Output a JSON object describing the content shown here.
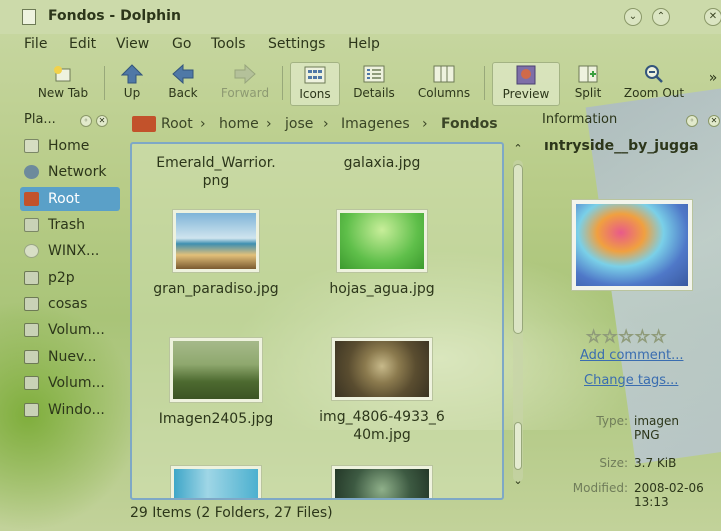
{
  "window": {
    "title": "Fondos - Dolphin",
    "btn_minimize": "⌄",
    "btn_maximize": "⌃",
    "btn_close": "✕"
  },
  "menubar": {
    "file": "File",
    "edit": "Edit",
    "view": "View",
    "go": "Go",
    "tools": "Tools",
    "settings": "Settings",
    "help": "Help"
  },
  "toolbar": {
    "new_tab": "New Tab",
    "up": "Up",
    "back": "Back",
    "forward": "Forward",
    "icons": "Icons",
    "details": "Details",
    "columns": "Columns",
    "preview": "Preview",
    "split": "Split",
    "zoom_out": "Zoom Out",
    "more": "»"
  },
  "places": {
    "title": "Pla...",
    "items": [
      {
        "label": "Home",
        "color": "#d6ddc2"
      },
      {
        "label": "Network",
        "color": "#6d8a9c"
      },
      {
        "label": "Root",
        "color": "#c2522b"
      },
      {
        "label": "Trash",
        "color": "#c9d2b6"
      },
      {
        "label": "WINX...",
        "color": "#c9d2b6"
      },
      {
        "label": "p2p",
        "color": "#c9d2b6"
      },
      {
        "label": "cosas",
        "color": "#c9d2b6"
      },
      {
        "label": "Volum...",
        "color": "#c9d2b6"
      },
      {
        "label": "Nuev...",
        "color": "#c9d2b6"
      },
      {
        "label": "Volum...",
        "color": "#c9d2b6"
      },
      {
        "label": "Windo...",
        "color": "#c9d2b6"
      }
    ]
  },
  "breadcrumb": {
    "items": [
      "Root",
      "home",
      "jose",
      "Imagenes",
      "Fondos"
    ]
  },
  "files": {
    "row0": [
      {
        "name": "Emerald_Warrior.\npng"
      },
      {
        "name": "galaxia.jpg"
      }
    ],
    "row1": [
      {
        "name": "gran_paradiso.jpg"
      },
      {
        "name": "hojas_agua.jpg"
      }
    ],
    "row2": [
      {
        "name": "Imagen2405.jpg"
      },
      {
        "name": "img_4806-4933_6\n40m.jpg"
      }
    ]
  },
  "status": {
    "text": "29 Items (2 Folders, 27 Files)"
  },
  "info": {
    "panel_title": "Information",
    "file_title": "ıntryside__by_jugga",
    "rating": 0,
    "add_comment": "Add comment...",
    "change_tags": "Change tags...",
    "type_label": "Type:",
    "type_value": "imagen PNG",
    "size_label": "Size:",
    "size_value": "3.7 KiB",
    "modified_label": "Modified:",
    "modified_value": "2008-02-06 13:13"
  },
  "colors": {
    "selection": "#5aa0c8",
    "link": "#3a6db0",
    "view_border": "#7ea8c6"
  }
}
